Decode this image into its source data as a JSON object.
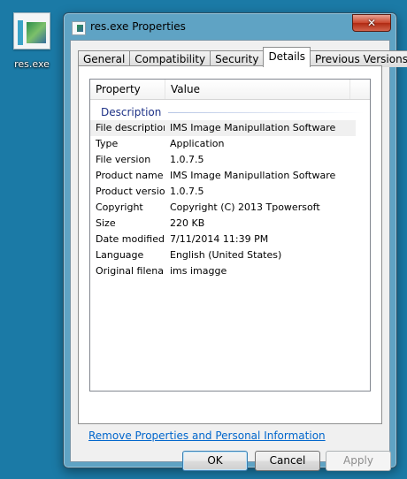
{
  "desktop": {
    "icon_label": "res.exe"
  },
  "window": {
    "title": "res.exe Properties",
    "close_glyph": "✕"
  },
  "tabs": [
    {
      "label": "General"
    },
    {
      "label": "Compatibility"
    },
    {
      "label": "Security"
    },
    {
      "label": "Details",
      "active": true
    },
    {
      "label": "Previous Versions"
    }
  ],
  "details": {
    "columns": {
      "property": "Property",
      "value": "Value"
    },
    "group": "Description",
    "rows": [
      {
        "key": "File description",
        "value": "IMS Image Manipullation Software"
      },
      {
        "key": "Type",
        "value": "Application"
      },
      {
        "key": "File version",
        "value": "1.0.7.5"
      },
      {
        "key": "Product name",
        "value": "IMS Image Manipullation Software"
      },
      {
        "key": "Product version",
        "value": "1.0.7.5"
      },
      {
        "key": "Copyright",
        "value": "Copyright (C) 2013 Tpowersoft"
      },
      {
        "key": "Size",
        "value": "220 KB"
      },
      {
        "key": "Date modified",
        "value": "7/11/2014 11:39 PM"
      },
      {
        "key": "Language",
        "value": "English (United States)"
      },
      {
        "key": "Original filename",
        "value": "ims imagge"
      }
    ]
  },
  "link": "Remove Properties and Personal Information",
  "buttons": {
    "ok": "OK",
    "cancel": "Cancel",
    "apply": "Apply"
  },
  "colors": {
    "desktop": "#1b7aa6",
    "window_frame": "#5fa3c4",
    "link": "#0066cc",
    "group_text": "#1e3287"
  },
  "icons": {
    "desktop_icon": "exe-file-icon",
    "title_icon": "exe-file-icon",
    "close": "close-icon"
  }
}
